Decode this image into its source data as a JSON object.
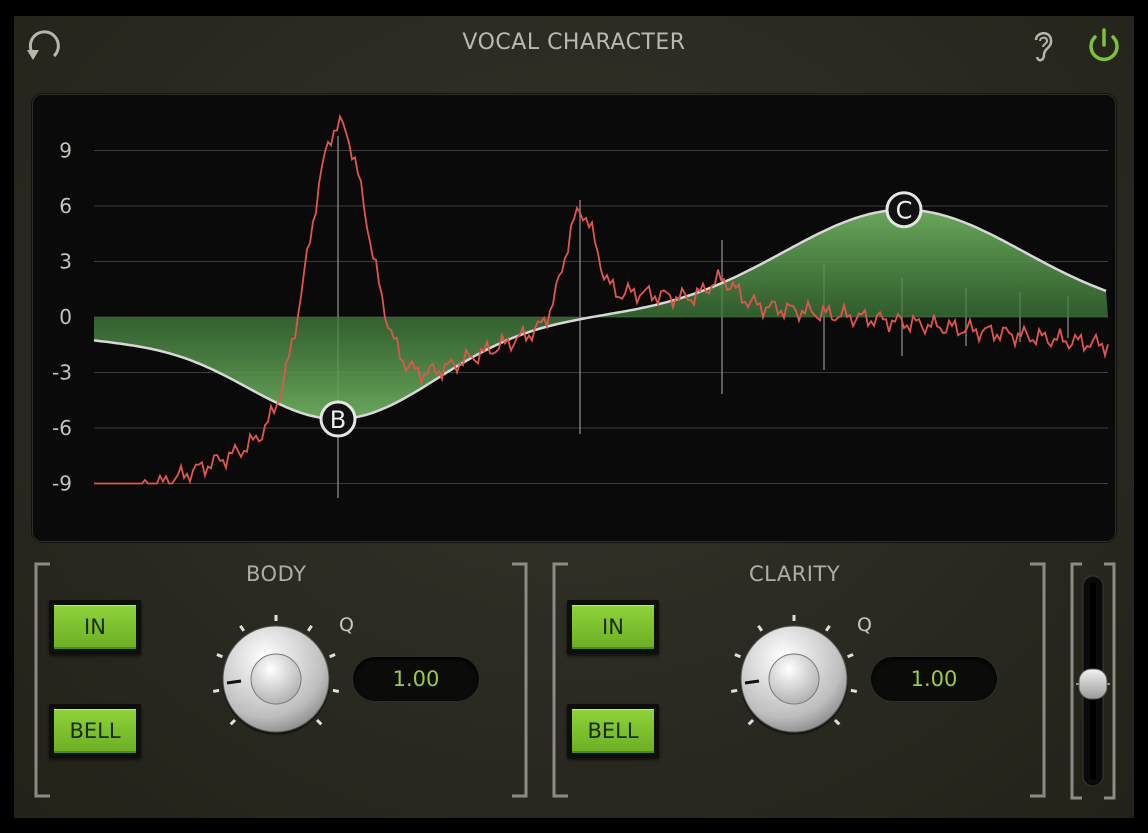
{
  "header": {
    "title": "VOCAL CHARACTER",
    "icons": {
      "undo": "undo-icon",
      "listen": "ear-icon",
      "power": "power-icon"
    },
    "power_color": "#7cc23a"
  },
  "graph": {
    "y_ticks": [
      "9",
      "6",
      "3",
      "0",
      "-3",
      "-6",
      "-9"
    ],
    "y_range": [
      -12,
      12
    ],
    "bands": [
      {
        "label": "B",
        "gain_db": -5.5
      },
      {
        "label": "C",
        "gain_db": 5.8
      }
    ],
    "colors": {
      "fill": "#5aa050",
      "curve": "#d8d8d8",
      "spectrum": "#e0564e",
      "grid": "#3c3c3c"
    }
  },
  "sections": [
    {
      "title": "BODY",
      "in_label": "IN",
      "shape_label": "BELL",
      "q_label": "Q",
      "q_value": "1.00"
    },
    {
      "title": "CLARITY",
      "in_label": "IN",
      "shape_label": "BELL",
      "q_label": "Q",
      "q_value": "1.00"
    }
  ],
  "output_fader": {
    "level": 0.5
  }
}
